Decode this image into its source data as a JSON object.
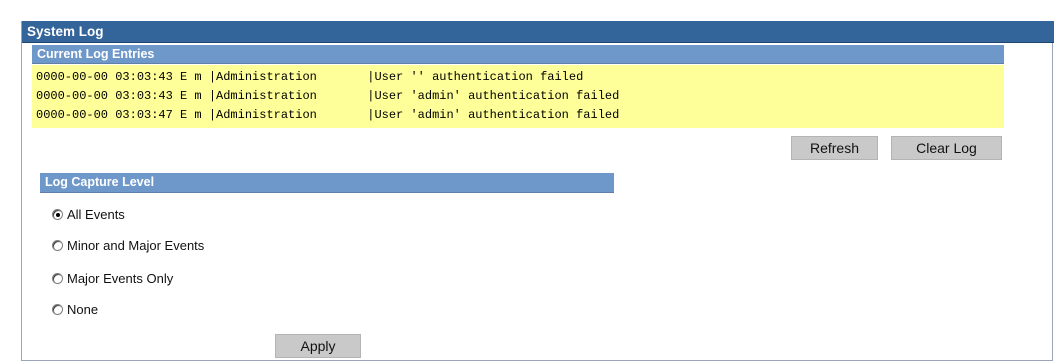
{
  "window": {
    "title": "System Log"
  },
  "log": {
    "header": "Current Log Entries",
    "entries": [
      "0000-00-00 03:03:43 E m |Administration       |User '' authentication failed",
      "0000-00-00 03:03:43 E m |Administration       |User 'admin' authentication failed",
      "0000-00-00 03:03:47 E m |Administration       |User 'admin' authentication failed"
    ],
    "refresh_label": "Refresh",
    "clear_label": "Clear Log"
  },
  "capture": {
    "header": "Log Capture Level",
    "options": [
      {
        "label": "All Events",
        "checked": true
      },
      {
        "label": "Minor and Major Events",
        "checked": false
      },
      {
        "label": "Major Events Only",
        "checked": false
      },
      {
        "label": "None",
        "checked": false
      }
    ],
    "apply_label": "Apply"
  },
  "colors": {
    "title_bar": "#34659a",
    "section_header": "#6f98ca",
    "log_background": "#ffff99",
    "button": "#c9c9c9"
  }
}
